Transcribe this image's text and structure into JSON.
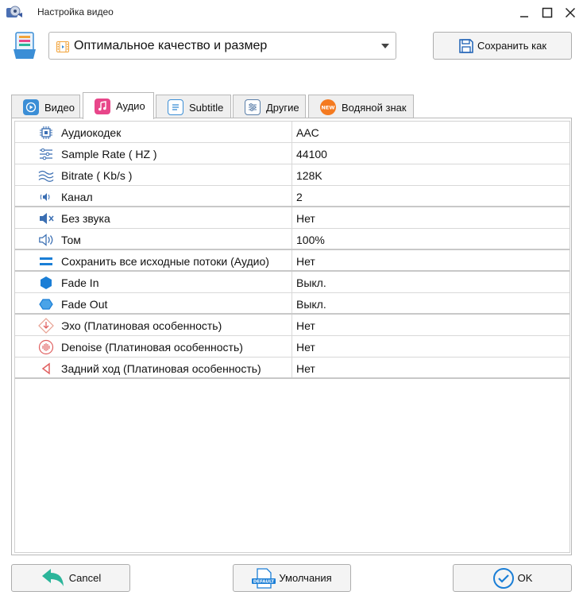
{
  "window": {
    "title": "Настройка видео"
  },
  "profile": {
    "selected": "Оптимальное качество и размер",
    "save_as_label": "Сохранить как"
  },
  "tabs": [
    {
      "label": "Видео",
      "icon": "video-icon",
      "active": false
    },
    {
      "label": "Аудио",
      "icon": "music-note-icon",
      "active": true
    },
    {
      "label": "Subtitle",
      "icon": "subtitle-icon",
      "active": false
    },
    {
      "label": "Другие",
      "icon": "sliders-icon",
      "active": false
    },
    {
      "label": "Водяной знак",
      "icon": "new-badge-icon",
      "active": false
    }
  ],
  "audio_settings": [
    {
      "label": "Аудиокодек",
      "value": "AAC",
      "icon": "chip-icon"
    },
    {
      "label": "Sample Rate ( HZ )",
      "value": "44100",
      "icon": "sample-rate-icon"
    },
    {
      "label": "Bitrate ( Kb/s )",
      "value": "128K",
      "icon": "wave-icon"
    },
    {
      "label": "Канал",
      "value": "2",
      "icon": "channel-icon"
    },
    {
      "label": "Без звука",
      "value": "Нет",
      "icon": "mute-icon"
    },
    {
      "label": "Том",
      "value": "100%",
      "icon": "volume-icon"
    },
    {
      "label": "Сохранить все исходные потоки (Аудио)",
      "value": "Нет",
      "icon": "streams-icon"
    },
    {
      "label": "Fade In",
      "value": "Выкл.",
      "icon": "fade-in-icon"
    },
    {
      "label": "Fade Out",
      "value": "Выкл.",
      "icon": "fade-out-icon"
    },
    {
      "label": "Эхо (Платиновая особенность)",
      "value": "Нет",
      "icon": "echo-icon"
    },
    {
      "label": "Denoise (Платиновая особенность)",
      "value": "Нет",
      "icon": "denoise-icon"
    },
    {
      "label": "Задний ход (Платиновая особенность)",
      "value": "Нет",
      "icon": "reverse-icon"
    }
  ],
  "footer": {
    "cancel_label": "Cancel",
    "defaults_label": "Умолчания",
    "ok_label": "OK",
    "defaults_badge": "DEFAULT"
  },
  "colors": {
    "accent": "#1a7ed6",
    "tab_active_icon": "#e8468a",
    "cancel_arrow": "#2bb59a"
  }
}
